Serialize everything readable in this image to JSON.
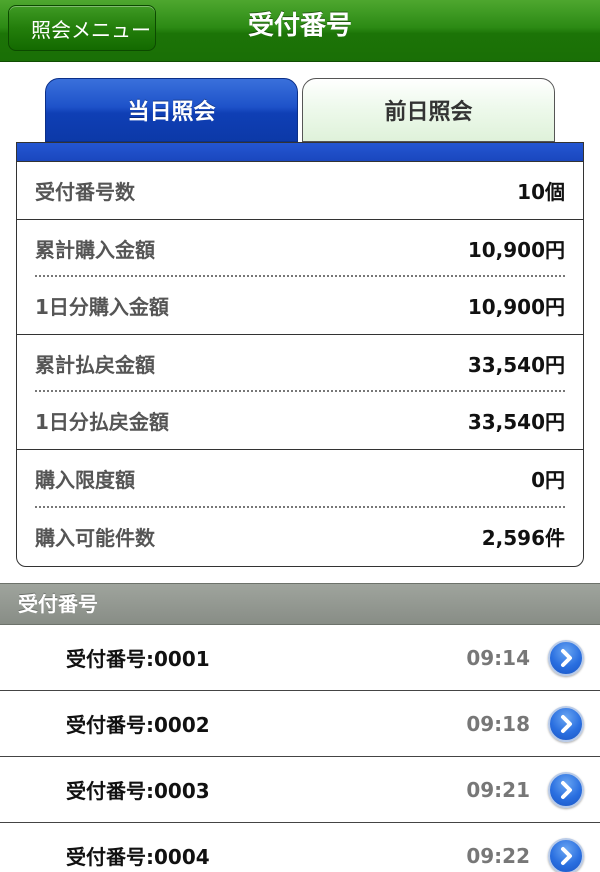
{
  "navbar": {
    "back_label": "照会メニュー",
    "title": "受付番号"
  },
  "tabs": [
    {
      "label": "当日照会",
      "selected": true
    },
    {
      "label": "前日照会",
      "selected": false
    }
  ],
  "summary": [
    {
      "label": "受付番号数",
      "value": "10個"
    },
    {
      "label": "累計購入金額",
      "value": "10,900円"
    },
    {
      "label": "1日分購入金額",
      "value": "10,900円"
    },
    {
      "label": "累計払戻金額",
      "value": "33,540円"
    },
    {
      "label": "1日分払戻金額",
      "value": "33,540円"
    },
    {
      "label": "購入限度額",
      "value": "0円"
    },
    {
      "label": "購入可能件数",
      "value": "2,596件"
    }
  ],
  "section": {
    "title": "受付番号"
  },
  "receipts": [
    {
      "label": "受付番号:0001",
      "time": "09:14"
    },
    {
      "label": "受付番号:0002",
      "time": "09:18"
    },
    {
      "label": "受付番号:0003",
      "time": "09:21"
    },
    {
      "label": "受付番号:0004",
      "time": "09:22"
    }
  ],
  "colors": {
    "navbar_green": "#1c7407",
    "tab_blue": "#0f3fb5",
    "tab_inactive_green": "#dff2da",
    "disclosure_blue": "#2a6fe0"
  }
}
